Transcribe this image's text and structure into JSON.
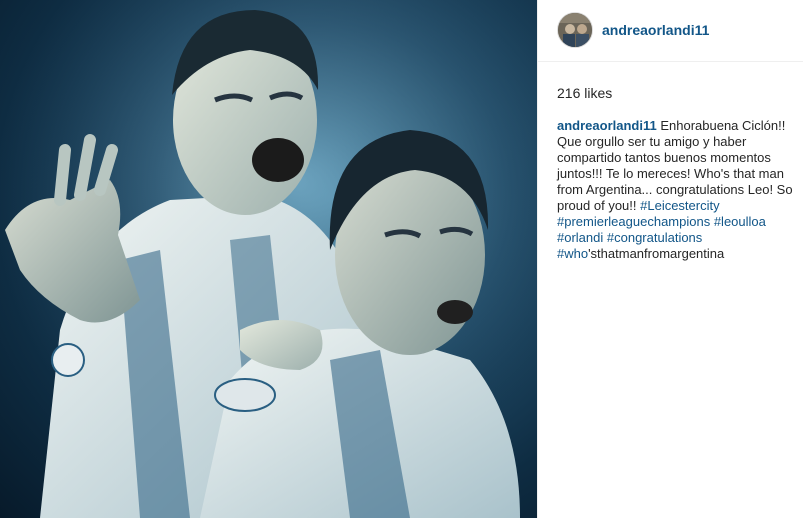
{
  "post": {
    "username": "andreaorlandi11",
    "likes_text": "216 likes"
  },
  "caption": {
    "username": "andreaorlandi11",
    "line1_text": " Enhorabuena Ciclón!!",
    "line2_text": "Que orgullo ser tu amigo y haber",
    "line3_text": "compartido tantos buenos momentos",
    "line4_text": "juntos!!! Te lo mereces! Who's that man",
    "line5_text": "from Argentina... congratulations Leo! So",
    "line6_text": "proud of you!! ",
    "tag_leicestercity": "#Leicestercity",
    "tag_premierleague": "#premierleaguechampions",
    "tag_leoulloa": "#leoulloa",
    "tag_orlandi": "#orlandi",
    "tag_congratulations": "#congratulations",
    "tag_who": "#who",
    "tail_text": "'sthatmanfromargentina"
  },
  "colors": {
    "link": "#125688",
    "text": "#262626",
    "divider": "#efefef",
    "photo_tint": "#1d4a66"
  },
  "icons": {
    "avatar": "profile-photo"
  }
}
